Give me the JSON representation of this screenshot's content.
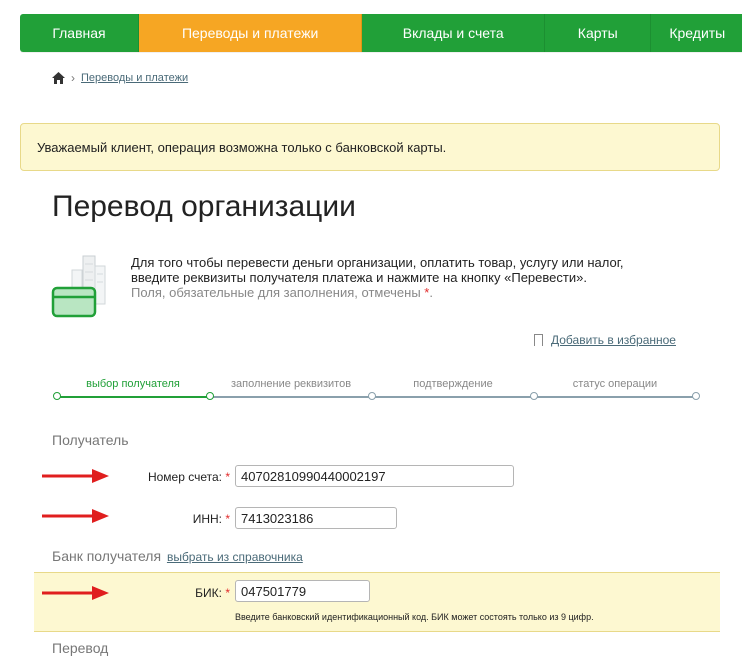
{
  "nav": {
    "tabs": [
      {
        "label": "Главная",
        "active": false
      },
      {
        "label": "Переводы и платежи",
        "active": true
      },
      {
        "label": "Вклады и счета",
        "active": false
      },
      {
        "label": "Карты",
        "active": false
      },
      {
        "label": "Кредиты",
        "active": false
      }
    ]
  },
  "breadcrumb": {
    "link": "Переводы и платежи"
  },
  "notice": {
    "text": "Уважаемый клиент, операция возможна только с банковской карты."
  },
  "page": {
    "title": "Перевод организации",
    "intro_line1": "Для того чтобы перевести деньги организации, оплатить товар, услугу или налог,",
    "intro_line2": "введите реквизиты получателя платежа и нажмите на кнопку «Перевести».",
    "required_hint": "Поля, обязательные для заполнения, отмечены",
    "required_star": "*",
    "required_end": ".",
    "favorite": "Добавить в избранное"
  },
  "steps": [
    {
      "label": "выбор получателя",
      "active": true
    },
    {
      "label": "заполнение реквизитов",
      "active": false
    },
    {
      "label": "подтверждение",
      "active": false
    },
    {
      "label": "статус операции",
      "active": false
    }
  ],
  "recipient": {
    "section": "Получатель",
    "account_label": "Номер счета:",
    "account_value": "40702810990440002197",
    "inn_label": "ИНН:",
    "inn_value": "7413023186"
  },
  "bank": {
    "section": "Банк получателя",
    "directory_link": "выбрать из справочника",
    "bik_label": "БИК:",
    "bik_value": "047501779",
    "bik_hint": "Введите банковский идентификационный код. БИК может состоять только из 9 цифр."
  },
  "transfer": {
    "section": "Перевод"
  },
  "colors": {
    "green": "#21a038",
    "orange": "#f6a623",
    "notice_bg": "#fdf8d1",
    "required": "#e12b2b",
    "arrow": "#e01e1e"
  }
}
